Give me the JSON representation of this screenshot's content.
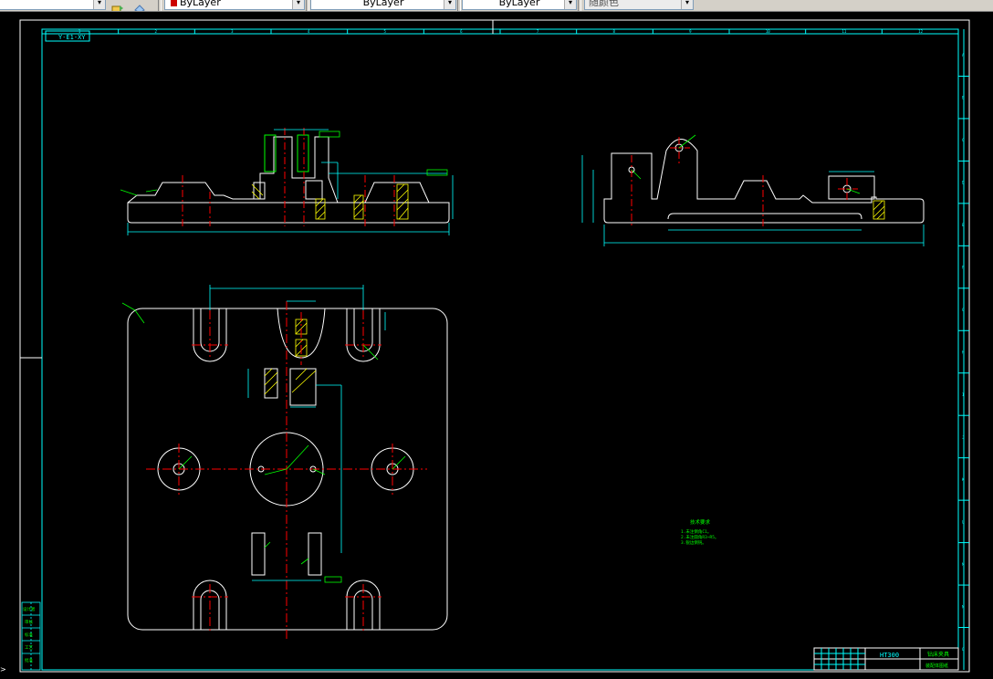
{
  "toolbar": {
    "arrow_glyph": "▾",
    "color_control": "ByLayer",
    "linetype_control": "ByLayer",
    "lineweight_control": "ByLayer",
    "plotstyle_control": "随颜色",
    "colors": {
      "bg": "#d4d0c8",
      "swatch": "#cc0000"
    }
  },
  "drawing": {
    "title_label": "Y-E1-XY",
    "material": "HT300",
    "part_name": "钻床夹具",
    "drawing_no": "装配体图纸",
    "tech_notes": {
      "heading": "技术要求",
      "lines": [
        "1.未注倒角C1。",
        "2.未注圆角R3~R5。",
        "3.锐边倒钝。"
      ]
    },
    "left_block_labels": [
      "设计者",
      "审核",
      "标准",
      "工艺",
      "批准"
    ],
    "colors": {
      "frame": "#00ffff",
      "geometry": "#ffffff",
      "centerline": "#ff0000",
      "dimension": "#00ff00",
      "hatch": "#ffff00",
      "border": "#ffffff"
    },
    "top_ruler": [
      "1",
      "2",
      "3",
      "4",
      "5",
      "6",
      "7",
      "8",
      "9",
      "10",
      "11",
      "12"
    ],
    "side_ruler": [
      "A",
      "B",
      "C",
      "D",
      "E",
      "F",
      "G",
      "H",
      "I",
      "J",
      "K",
      "L",
      "M",
      "N",
      "O"
    ]
  },
  "command": {
    "prompt": ">"
  }
}
